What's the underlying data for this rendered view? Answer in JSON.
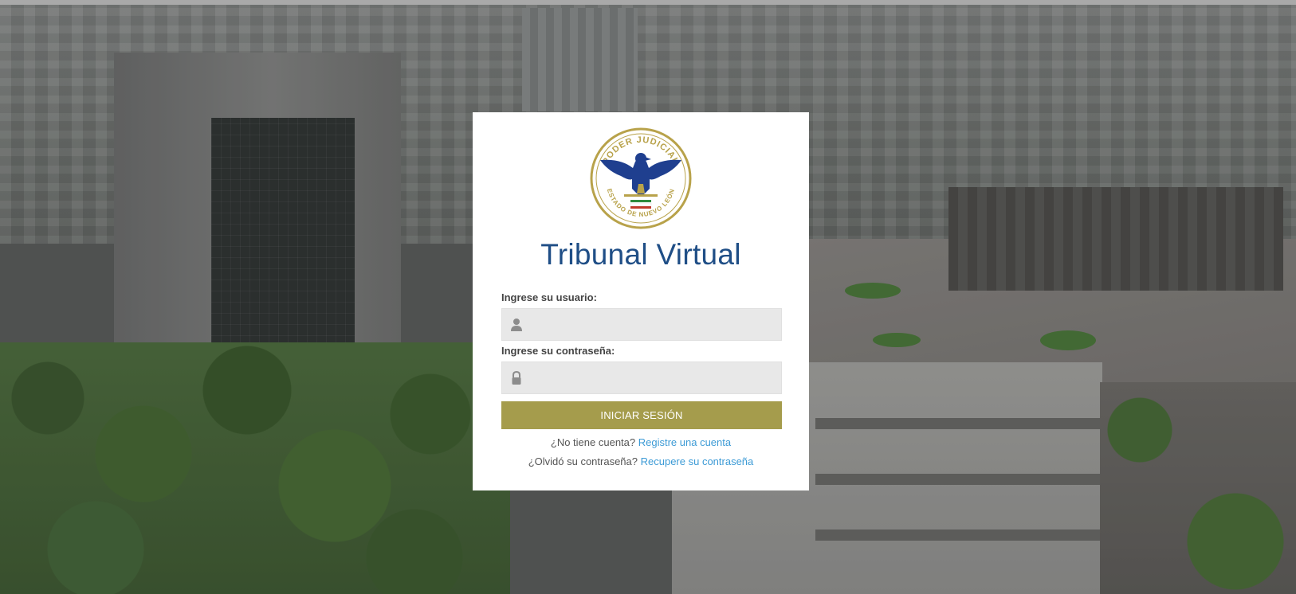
{
  "login": {
    "logo_text_top": "PODER JUDICIAL",
    "logo_text_bottom": "ESTADO DE NUEVO LEÓN",
    "title": "Tribunal Virtual",
    "username_label": "Ingrese su usuario:",
    "username_value": "",
    "username_icon": "user-icon",
    "password_label": "Ingrese su contraseña:",
    "password_value": "",
    "password_icon": "lock-icon",
    "submit_label": "INICIAR SESIÓN",
    "register_prompt": "¿No tiene cuenta?",
    "register_link": "Registre una cuenta",
    "recover_prompt": "¿Olvidó su contraseña?",
    "recover_link": "Recupere su contraseña"
  },
  "colors": {
    "title": "#1f4e86",
    "button": "#a59c4c",
    "link": "#3d9bd6",
    "logo_gold": "#b8a24a",
    "logo_blue": "#1f3f8f"
  }
}
